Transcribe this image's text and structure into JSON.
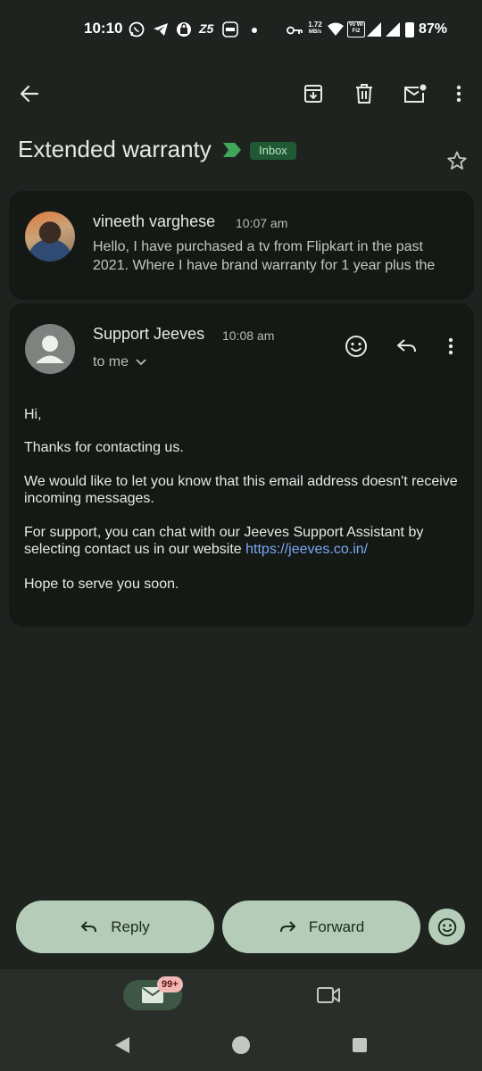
{
  "status_bar": {
    "time": "10:10",
    "speed_value": "1.72",
    "speed_unit": "MB/s",
    "wifi_label": "Vo WiFi2",
    "battery": "87%"
  },
  "toolbar": {
    "icons": [
      "back-arrow-icon",
      "archive-icon",
      "delete-icon",
      "mark-unread-icon",
      "more-vert-icon"
    ]
  },
  "thread": {
    "subject": "Extended warranty",
    "label": "Inbox"
  },
  "messages": [
    {
      "sender": "vineeth varghese",
      "time": "10:07 am",
      "snippet": "Hello, I have purchased a tv from Flipkart in the past 2021. Where I have brand warranty for 1 year plus the"
    },
    {
      "sender": "Support Jeeves",
      "time": "10:08 am",
      "recipient": "to me",
      "body": {
        "greeting": "Hi,",
        "p1": "Thanks for contacting us.",
        "p2": "We would like to let you know that this email address doesn't receive incoming messages.",
        "p3_text": "For support, you can chat with our Jeeves Support Assistant by selecting contact us in our website ",
        "p3_link": "https://jeeves.co.in/",
        "p4": "Hope to serve you soon."
      }
    }
  ],
  "actions": {
    "reply_label": "Reply",
    "forward_label": "Forward"
  },
  "bottom_nav": {
    "mail_badge": "99+"
  },
  "colors": {
    "background": "#1f2320",
    "card": "#151916",
    "pill": "#b5cdb8",
    "inbox_chip": "#205a34",
    "link": "#7aa7f5"
  }
}
